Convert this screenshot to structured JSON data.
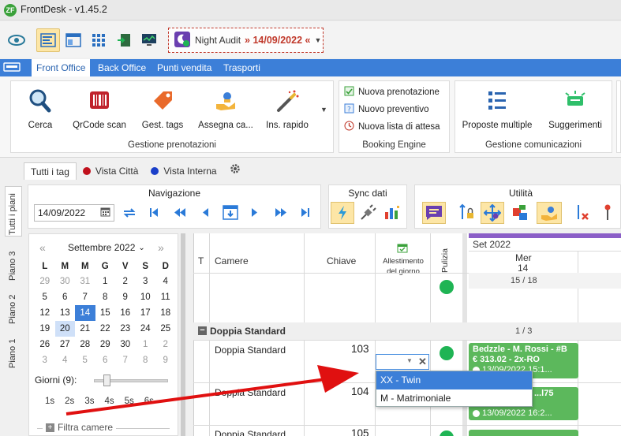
{
  "app": {
    "logo": "ZF",
    "title": "FrontDesk - v1.45.2"
  },
  "toolbar": {
    "icons": [
      "eye-icon",
      "list-view-icon",
      "window-view-icon",
      "grid-view-icon",
      "exit-icon",
      "monitor-icon"
    ],
    "night_audit_label": "Night Audit",
    "night_audit_date": "» 14/09/2022 «"
  },
  "ribbon_tabs": [
    "Front Office",
    "Back Office",
    "Punti vendita",
    "Trasporti"
  ],
  "ribbon": {
    "gestione": {
      "label": "Gestione prenotazioni",
      "buttons": [
        "Cerca",
        "QrCode scan",
        "Gest. tags",
        "Assegna ca...",
        "Ins. rapido"
      ]
    },
    "booking": {
      "label": "Booking Engine",
      "items": [
        "Nuova prenotazione",
        "Nuovo preventivo",
        "Nuova lista di attesa"
      ]
    },
    "comunicazioni": {
      "label": "Gestione comunicazioni",
      "buttons": [
        "Proposte multiple",
        "Suggerimenti"
      ]
    }
  },
  "view_tabs": [
    {
      "label": "Tutti i tag",
      "color": ""
    },
    {
      "label": "Vista Città",
      "color": "#c0101c"
    },
    {
      "label": "Vista Interna",
      "color": "#1a3fc9"
    }
  ],
  "side_tabs": [
    "Tutti i piani",
    "Piano 3",
    "Piano 2",
    "Piano 1"
  ],
  "navigazione": {
    "label": "Navigazione",
    "date": "14/09/2022"
  },
  "sync": {
    "label": "Sync dati"
  },
  "utilita": {
    "label": "Utilità"
  },
  "calendar": {
    "month": "Settembre 2022",
    "weekdays": [
      "L",
      "M",
      "M",
      "G",
      "V",
      "S",
      "D"
    ],
    "weeks": [
      [
        "29",
        "30",
        "31",
        "1",
        "2",
        "3",
        "4"
      ],
      [
        "5",
        "6",
        "7",
        "8",
        "9",
        "10",
        "11"
      ],
      [
        "12",
        "13",
        "14",
        "15",
        "16",
        "17",
        "18"
      ],
      [
        "19",
        "20",
        "21",
        "22",
        "23",
        "24",
        "25"
      ],
      [
        "26",
        "27",
        "28",
        "29",
        "30",
        "1",
        "2"
      ],
      [
        "3",
        "4",
        "5",
        "6",
        "7",
        "8",
        "9"
      ]
    ],
    "giorni_label": "Giorni (9):",
    "span_options": [
      "1s",
      "2s",
      "3s",
      "4s",
      "5s",
      "6s"
    ],
    "filter_label": "Filtra camere"
  },
  "grid": {
    "headers": {
      "t": "T",
      "camere": "Camere",
      "chiave": "Chiave",
      "allestimento": "Allestimento del giorno",
      "pulizia": "Pulizia"
    },
    "month_header": "Set 2022",
    "day_name": "Mer",
    "day_num": "14",
    "count_all": "15 / 18",
    "section_title": "Doppia Standard",
    "section_count": "1 / 3",
    "rows": [
      {
        "camera": "Doppia Standard",
        "chiave": "103"
      },
      {
        "camera": "Doppia Standard",
        "chiave": "104"
      },
      {
        "camera": "Doppia Standard",
        "chiave": "105"
      }
    ],
    "bookings": [
      {
        "line1": "Bedzzle - M. Rossi - #B",
        "line2": "€ 313.02 - 2x-RO",
        "line3": "13/09/2022 15:1..."
      },
      {
        "line1": "...l75",
        "line2": "",
        "line3": "13/09/2022 16:2..."
      }
    ],
    "dropdown_options": [
      "XX - Twin",
      "M - Matrimoniale"
    ]
  }
}
